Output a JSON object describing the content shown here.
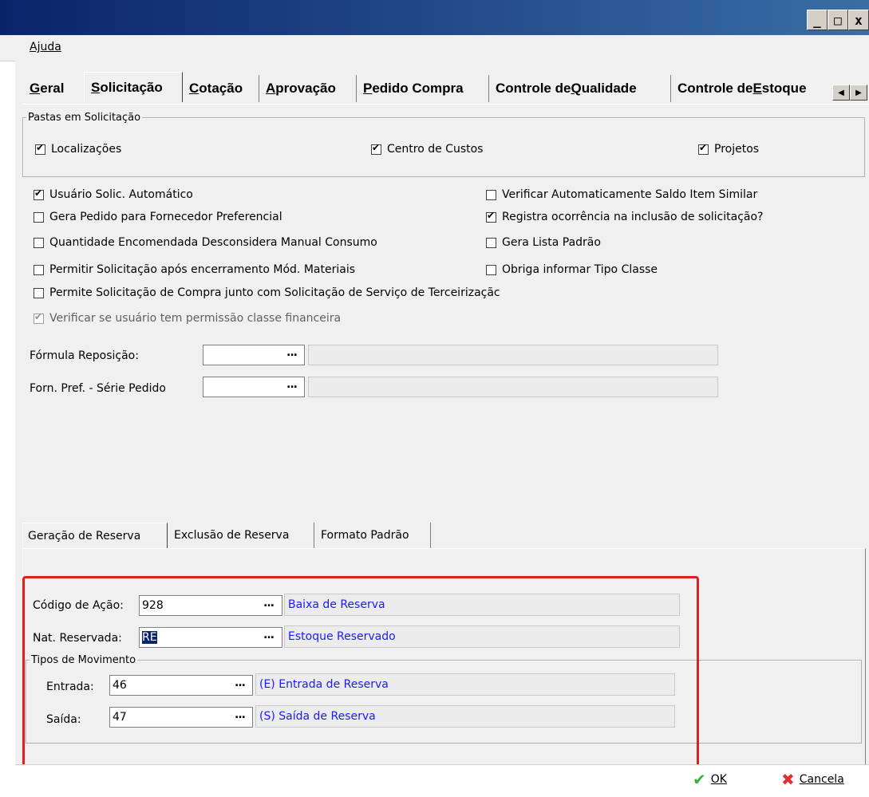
{
  "window": {
    "minimize_icon": "_",
    "maximize_icon": "□",
    "close_icon": "x"
  },
  "menu": {
    "help": "Ajuda"
  },
  "tabs": [
    {
      "label": "Geral",
      "underline": "G",
      "rest": "eral"
    },
    {
      "label": "Solicitação",
      "underline": "S",
      "rest": "olicitação"
    },
    {
      "label": "Cotação",
      "underline": "C",
      "rest": "otação"
    },
    {
      "label": "Aprovação",
      "underline": "A",
      "rest": "provação"
    },
    {
      "label": "Pedido Compra",
      "underline": "P",
      "rest": "edido Compra"
    },
    {
      "label": "Controle de Qualidade",
      "pre": "Controle de ",
      "underline": "Q",
      "rest": "ualidade"
    },
    {
      "label": "Controle de Estoque",
      "pre": "Controle de ",
      "underline": "E",
      "rest": "stoque"
    }
  ],
  "pastas": {
    "legend": "Pastas em Solicitação",
    "localizacoes": "Localizações",
    "centro_custos": "Centro de Custos",
    "projetos": "Projetos"
  },
  "options": {
    "usuario_solic": "Usuário Solic. Automático",
    "gera_pedido": "Gera Pedido para Fornecedor Preferencial",
    "quantidade": "Quantidade Encomendada Desconsidera Manual Consumo",
    "permitir_solic": "Permitir Solicitação após encerramento Mód. Materiais",
    "permite_solic_compra": "Permite Solicitação de Compra junto com Solicitação de Serviço de Terceirizaçãc",
    "verificar_usuario": "Verificar se usuário tem permissão classe financeira",
    "verificar_saldo": "Verificar Automaticamente Saldo Item Similar",
    "registra_ocorrencia": "Registra ocorrência na inclusão de solicitação?",
    "gera_lista": "Gera Lista Padrão",
    "obriga_tipo": "Obriga informar Tipo Classe"
  },
  "fields": {
    "formula_label": "Fórmula Reposição:",
    "forn_label": "Forn. Pref. - Série Pedido",
    "ellipsis": "..."
  },
  "subtabs": [
    "Geração de Reserva",
    "Exclusão de Reserva",
    "Formato Padrão"
  ],
  "reserva": {
    "codigo_label": "Código de Ação:",
    "codigo_value": "928",
    "codigo_desc": "Baixa de Reserva",
    "nat_label": "Nat. Reservada:",
    "nat_value": "RE",
    "nat_desc": "Estoque Reservado",
    "tipos_legend": "Tipos de Movimento",
    "entrada_label": "Entrada:",
    "entrada_value": "46",
    "entrada_desc": "(E) Entrada de Reserva",
    "saida_label": "Saída:",
    "saida_value": "47",
    "saida_desc": "(S) Saída de Reserva"
  },
  "footer": {
    "ok": "OK",
    "cancel": "Cancela"
  }
}
